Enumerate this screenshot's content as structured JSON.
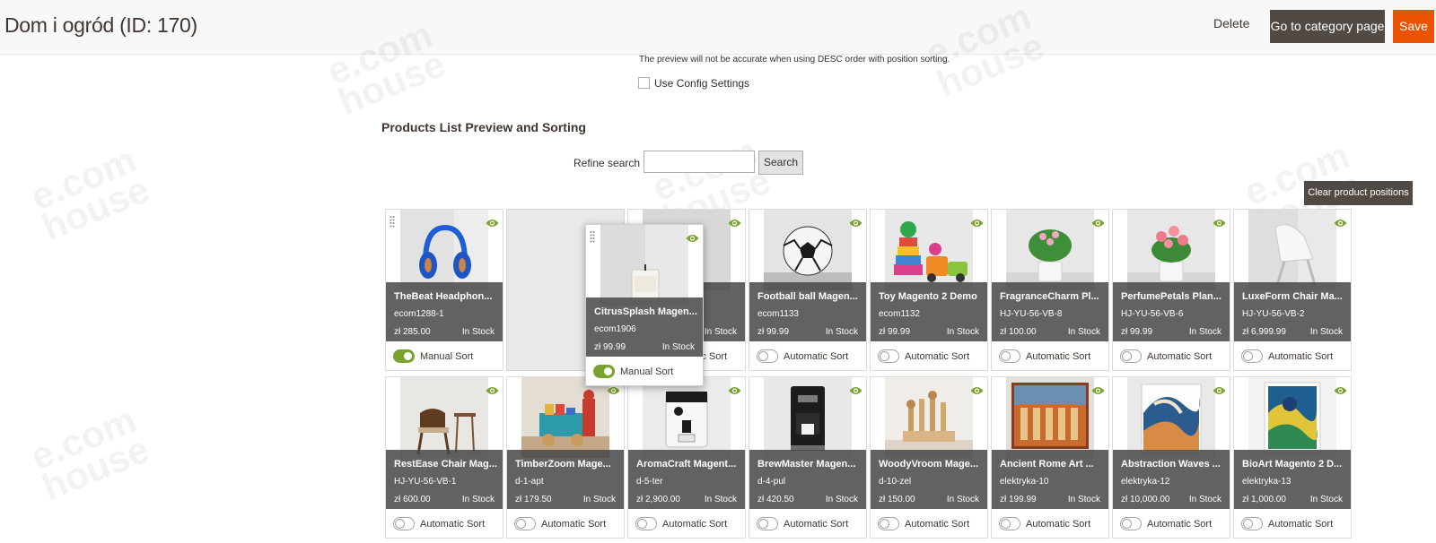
{
  "header": {
    "title": "Dom i ogród (ID: 170)",
    "delete_label": "Delete",
    "goto_label": "Go to category page",
    "save_label": "Save"
  },
  "settings": {
    "note": "The preview will not be accurate when using DESC order with position sorting.",
    "use_config_label": "Use Config Settings"
  },
  "section": {
    "title": "Products List Preview and Sorting",
    "refine_label": "Refine search",
    "search_value": "",
    "search_button": "Search",
    "clear_button": "Clear product positions"
  },
  "watermark": {
    "line1": "e.com",
    "line2": "house"
  },
  "colors": {
    "accent_green": "#79a22e",
    "save_orange": "#eb5202",
    "dark_button": "#514943"
  },
  "products": [
    {
      "name": "TheBeat Headphon...",
      "sku": "ecom1288-1",
      "price": "zł 285.00",
      "stock": "In Stock",
      "sort": "Manual Sort",
      "manual": true,
      "image": "headphones"
    },
    {
      "name": "CitrusSplash Magen...",
      "sku": "ecom1906",
      "price": "zł 99.99",
      "stock": "In Stock",
      "sort": "Manual Sort",
      "manual": true,
      "image": "candle"
    },
    {
      "name": "...age...",
      "sku": "",
      "price": "",
      "stock": "In Stock",
      "sort": "Automatic Sort",
      "manual": false,
      "image": "hidden"
    },
    {
      "name": "Football ball Magen...",
      "sku": "ecom1133",
      "price": "zł 99.99",
      "stock": "In Stock",
      "sort": "Automatic Sort",
      "manual": false,
      "image": "football"
    },
    {
      "name": "Toy Magento 2 Demo",
      "sku": "ecom1132",
      "price": "zł 99.99",
      "stock": "In Stock",
      "sort": "Automatic Sort",
      "manual": false,
      "image": "toys"
    },
    {
      "name": "FragranceCharm Pl...",
      "sku": "HJ-YU-56-VB-8",
      "price": "zł 100.00",
      "stock": "In Stock",
      "sort": "Automatic Sort",
      "manual": false,
      "image": "plant-green"
    },
    {
      "name": "PerfumePetals Plan...",
      "sku": "HJ-YU-56-VB-6",
      "price": "zł 99.99",
      "stock": "In Stock",
      "sort": "Automatic Sort",
      "manual": false,
      "image": "plant-pink"
    },
    {
      "name": "LuxeForm Chair Ma...",
      "sku": "HJ-YU-56-VB-2",
      "price": "zł 6,999.99",
      "stock": "In Stock",
      "sort": "Automatic Sort",
      "manual": false,
      "image": "chair-white"
    },
    {
      "name": "RestEase Chair Mag...",
      "sku": "HJ-YU-56-VB-1",
      "price": "zł 600.00",
      "stock": "In Stock",
      "sort": "Automatic Sort",
      "manual": false,
      "image": "chair-wood"
    },
    {
      "name": "TimberZoom Mage...",
      "sku": "d-1-apt",
      "price": "zł 179.50",
      "stock": "In Stock",
      "sort": "Automatic Sort",
      "manual": false,
      "image": "toy-truck"
    },
    {
      "name": "AromaCraft Magent...",
      "sku": "d-5-ter",
      "price": "zł 2,900.00",
      "stock": "In Stock",
      "sort": "Automatic Sort",
      "manual": false,
      "image": "espresso"
    },
    {
      "name": "BrewMaster Magen...",
      "sku": "d-4-pul",
      "price": "zł 420.50",
      "stock": "In Stock",
      "sort": "Automatic Sort",
      "manual": false,
      "image": "coffee-maker"
    },
    {
      "name": "WoodyVroom Mage...",
      "sku": "d-10-zel",
      "price": "zł 150.00",
      "stock": "In Stock",
      "sort": "Automatic Sort",
      "manual": false,
      "image": "wood-toy"
    },
    {
      "name": "Ancient Rome Art ...",
      "sku": "elektryka-10",
      "price": "zł 199.99",
      "stock": "In Stock",
      "sort": "Automatic Sort",
      "manual": false,
      "image": "painting-rome"
    },
    {
      "name": "Abstraction Waves ...",
      "sku": "elektryka-12",
      "price": "zł 10,000.00",
      "stock": "In Stock",
      "sort": "Automatic Sort",
      "manual": false,
      "image": "painting-waves"
    },
    {
      "name": "BioArt Magento 2 D...",
      "sku": "elektryka-13",
      "price": "zł 1,000.00",
      "stock": "In Stock",
      "sort": "Automatic Sort",
      "manual": false,
      "image": "painting-bio"
    }
  ]
}
